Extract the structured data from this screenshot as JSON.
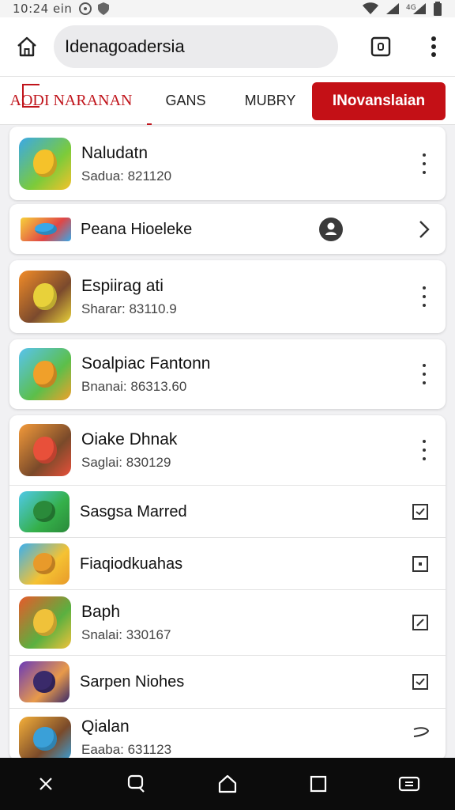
{
  "status_bar": {
    "time": "10:24 ein"
  },
  "browser": {
    "url": "Idenagoadersia"
  },
  "nav": {
    "brand": "AODI NARANAN",
    "tabs": [
      "GANS",
      "MUBRY"
    ],
    "cta": "INovanslaian"
  },
  "items": [
    {
      "title": "Naludatn",
      "subtitle": "Sadua: 821120",
      "action": "kebab",
      "colors": [
        "#3aa8e8",
        "#7ccb3a",
        "#f5c22a"
      ]
    },
    {
      "title": "Peana Hioeleke",
      "subtitle": "",
      "action": "chevron",
      "badge": "person",
      "colors": [
        "#f7d13a",
        "#e04646",
        "#38a8e8"
      ]
    },
    {
      "title": "Espiirag ati",
      "subtitle": "Sharar: 83110.9",
      "action": "kebab",
      "colors": [
        "#f28c28",
        "#7b4a2d",
        "#e8d13a"
      ]
    },
    {
      "title": "Soalpiac Fantonn",
      "subtitle": "Bnanai: 86313.60",
      "action": "kebab",
      "colors": [
        "#58c3ef",
        "#5cbf4a",
        "#f0a02a"
      ]
    },
    {
      "title": "Oiake Dhnak",
      "subtitle": "Saglai: 830129",
      "action": "kebab",
      "colors": [
        "#f39a3a",
        "#7a4a2a",
        "#e8503a"
      ]
    },
    {
      "title": "Sasgsa Marred",
      "subtitle": "",
      "action": "check",
      "colors": [
        "#4fc9e8",
        "#35b04a",
        "#2a8a3a"
      ]
    },
    {
      "title": "Fiaqiodkuahas",
      "subtitle": "",
      "action": "square",
      "colors": [
        "#3ab0f0",
        "#f5c232",
        "#e89a2a"
      ]
    },
    {
      "title": "Baph",
      "subtitle": "Snalai: 330167",
      "action": "check-edit",
      "colors": [
        "#e85a2a",
        "#5ab040",
        "#f0c23a"
      ]
    },
    {
      "title": "Sarpen Niohes",
      "subtitle": "",
      "action": "check",
      "colors": [
        "#6a3ab8",
        "#e89a4a",
        "#3a2a6a"
      ]
    },
    {
      "title": "Qialan",
      "subtitle": "Eaaba: 631123",
      "action": "swipe",
      "colors": [
        "#f5b03a",
        "#7a4a2a",
        "#3aa0d8"
      ]
    }
  ]
}
